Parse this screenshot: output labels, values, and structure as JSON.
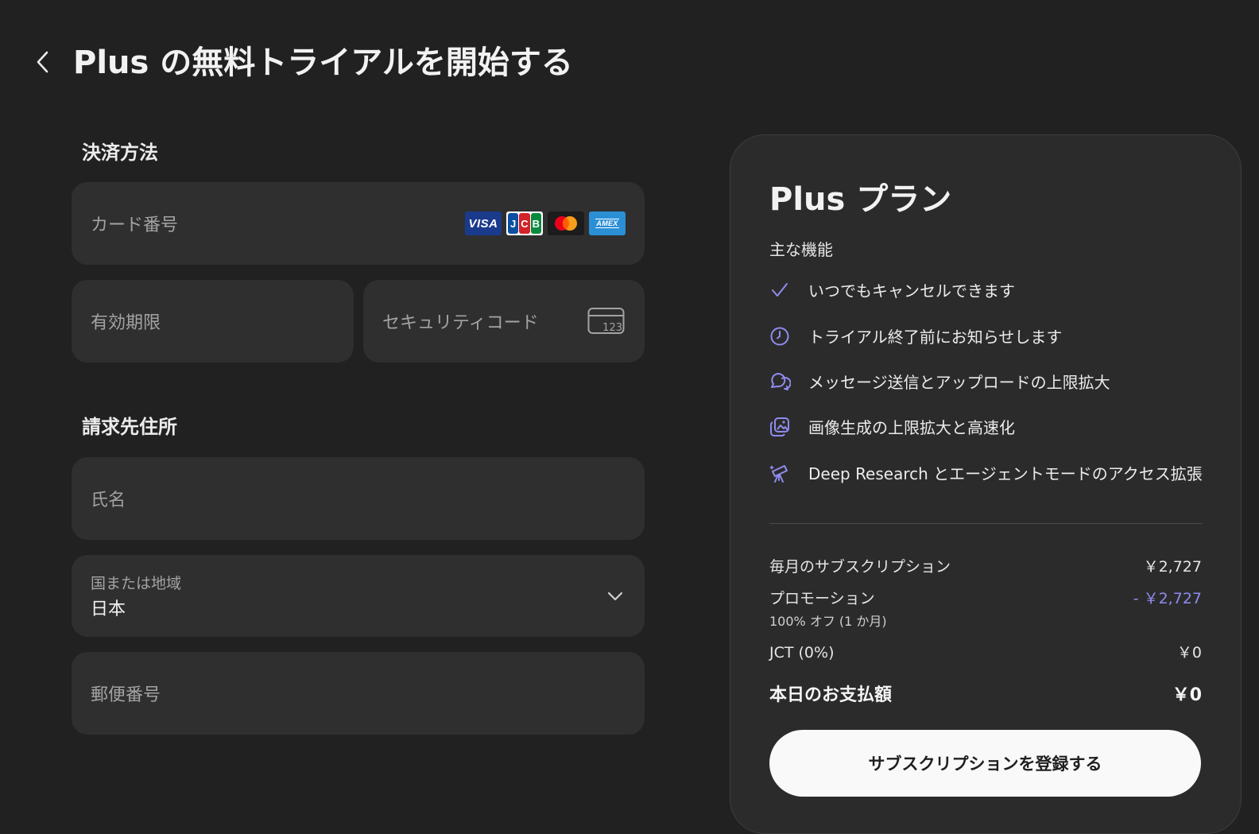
{
  "header": {
    "title": "Plus の無料トライアルを開始する",
    "back_icon": "chevron-left-icon"
  },
  "payment": {
    "heading": "決済方法",
    "card_number_placeholder": "カード番号",
    "card_brands": [
      "VISA",
      "JCB",
      "Mastercard",
      "AMEX"
    ],
    "expiry_placeholder": "有効期限",
    "security_code_placeholder": "セキュリティコード",
    "security_code_icon_text": "123"
  },
  "billing": {
    "heading": "請求先住所",
    "name_placeholder": "氏名",
    "country_label": "国または地域",
    "country_value": "日本",
    "postal_placeholder": "郵便番号"
  },
  "plan": {
    "title": "Plus プラン",
    "features_heading": "主な機能",
    "features": [
      {
        "icon": "check-icon",
        "text": "いつでもキャンセルできます"
      },
      {
        "icon": "clock-icon",
        "text": "トライアル終了前にお知らせします"
      },
      {
        "icon": "chat-bubbles-icon",
        "text": "メッセージ送信とアップロードの上限拡大"
      },
      {
        "icon": "image-icon",
        "text": "画像生成の上限拡大と高速化"
      },
      {
        "icon": "telescope-icon",
        "text": "Deep Research とエージェントモードのアクセス拡張"
      }
    ],
    "monthly_label": "毎月のサブスクリプション",
    "monthly_value": "￥2,727",
    "promotion_label": "プロモーション",
    "promotion_value": "- ￥2,727",
    "promotion_detail": "100% オフ (1 か月)",
    "tax_label": "JCT (0%)",
    "tax_value": "￥0",
    "total_label": "本日のお支払額",
    "total_value": "￥0",
    "subscribe_label": "サブスクリプションを登録する"
  },
  "colors": {
    "background": "#212121",
    "field": "#2f2f2f",
    "card": "#2b2b2b",
    "accent": "#8f8cf0",
    "button": "#f9f9f9"
  }
}
